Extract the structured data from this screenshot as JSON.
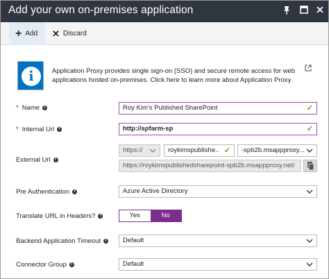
{
  "window": {
    "title": "Add your own on-premises application"
  },
  "toolbar": {
    "add_label": "Add",
    "discard_label": "Discard"
  },
  "info": {
    "text": "Application Proxy provides single sign-on (SSO) and secure remote access for web applications hosted on-premises. Click here to learn more about Application Proxy."
  },
  "form": {
    "name": {
      "label": "Name",
      "value": "Roy Kim's Published SharePoint"
    },
    "internal_url": {
      "label": "Internal Url",
      "value": "http://spfarm-sp"
    },
    "external_url": {
      "label": "External Url",
      "scheme": "https://",
      "subdomain": "roykimspublishe..",
      "domain": "-spb2b.msappproxy...",
      "full": "https://roykimspublishedsharepoint-spb2b.msappproxy.net/"
    },
    "pre_auth": {
      "label": "Pre Authentication",
      "value": "Azure Active Directory"
    },
    "translate_url": {
      "label": "Translate URL in Headers?",
      "yes": "Yes",
      "no": "No",
      "selected": "No"
    },
    "backend_timeout": {
      "label": "Backend Application Timeout",
      "value": "Default"
    },
    "connector_group": {
      "label": "Connector Group",
      "value": "Default"
    }
  },
  "colors": {
    "titlebar": "#2f3640",
    "accent_purple": "#7a2d8e",
    "focus_border": "#a34ab6",
    "valid_check": "#5aa419",
    "info_blue": "#0072c6"
  }
}
